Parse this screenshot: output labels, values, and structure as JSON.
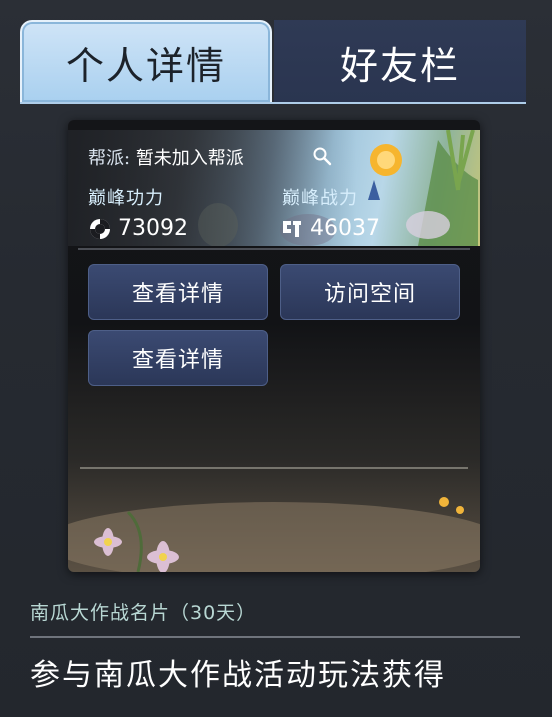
{
  "tabs": [
    {
      "label": "个人详情",
      "active": true
    },
    {
      "label": "好友栏",
      "active": false
    }
  ],
  "card": {
    "guild_label": "帮派:",
    "guild_value": "暂未加入帮派",
    "stats": [
      {
        "label": "巅峰功力",
        "value": "73092",
        "icon": "peak-power-icon"
      },
      {
        "label": "巅峰战力",
        "value": "46037",
        "icon": "combat-power-icon"
      }
    ],
    "buttons": [
      "查看详情",
      "访问空间",
      "查看详情"
    ]
  },
  "item": {
    "name": "南瓜大作战名片（30天）",
    "description": "参与南瓜大作战活动玩法获得"
  },
  "colors": {
    "tab_active": "#b8d9f2",
    "tab_inactive": "#2d3853",
    "button": "#33405f",
    "item_name": "#b8d7d3"
  }
}
